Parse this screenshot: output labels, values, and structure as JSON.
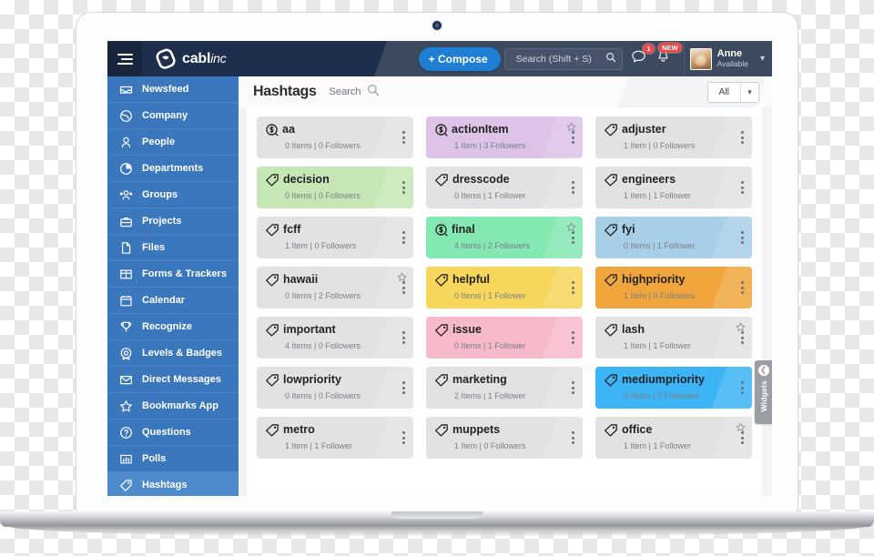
{
  "app": {
    "brand_name": "cabl",
    "brand_name_italic": "inc",
    "hamburger_icon": "hamburger-menu-icon",
    "logo_icon": "cablinc-logo-icon"
  },
  "topbar": {
    "compose_label": "+ Compose",
    "search_placeholder": "Search (Shift + S)",
    "search_value": "",
    "search_icon": "search-icon",
    "messages_icon": "chat-bubble-icon",
    "messages_badge": "1",
    "notifications_icon": "bell-icon",
    "notifications_badge": "NEW",
    "user_name": "Anne",
    "user_status": "Available",
    "user_caret": "chevron-down-icon"
  },
  "sidebar": {
    "items": [
      {
        "label": "Newsfeed",
        "icon": "inbox-icon",
        "active": false
      },
      {
        "label": "Company",
        "icon": "globe-icon",
        "active": false
      },
      {
        "label": "People",
        "icon": "person-icon",
        "active": false
      },
      {
        "label": "Departments",
        "icon": "pie-chart-icon",
        "active": false
      },
      {
        "label": "Groups",
        "icon": "people-group-icon",
        "active": false
      },
      {
        "label": "Projects",
        "icon": "briefcase-icon",
        "active": false
      },
      {
        "label": "Files",
        "icon": "file-icon",
        "active": false
      },
      {
        "label": "Forms & Trackers",
        "icon": "grid-table-icon",
        "active": false
      },
      {
        "label": "Calendar",
        "icon": "calendar-icon",
        "active": false
      },
      {
        "label": "Recognize",
        "icon": "trophy-icon",
        "active": false
      },
      {
        "label": "Levels & Badges",
        "icon": "badge-icon",
        "active": false
      },
      {
        "label": "Direct Messages",
        "icon": "envelope-icon",
        "active": false
      },
      {
        "label": "Bookmarks App",
        "icon": "star-icon",
        "active": false
      },
      {
        "label": "Questions",
        "icon": "question-mark-icon",
        "active": false
      },
      {
        "label": "Polls",
        "icon": "bar-chart-icon",
        "active": false
      },
      {
        "label": "Hashtags",
        "icon": "tag-icon",
        "active": true
      }
    ]
  },
  "page": {
    "title": "Hashtags",
    "search_label": "Search",
    "search_icon": "search-icon",
    "filter_value": "All",
    "filter_caret": "chevron-down-icon"
  },
  "widgets_panel": {
    "label": "Widgets",
    "collapse_icon": "chevron-left-icon"
  },
  "colors": {
    "topbar": "#1e2f4d",
    "topbar_right": "#3c4a60",
    "sidebar": "#3b77bd",
    "sidebar_active": "#4d8bcd",
    "accent_blue": "#1e7fd4",
    "badge_red": "#e94b4b",
    "card_default": "#e2e2e2",
    "card_purple": "#ddc3e8",
    "card_green_light": "#c6e7b5",
    "card_green_mint": "#84e8b2",
    "card_blue_light": "#a8cfe8",
    "card_yellow": "#f7d65c",
    "card_orange": "#f0a63c",
    "card_pink": "#f7bacb",
    "card_blue_bright": "#3cb4f5"
  },
  "cards": [
    {
      "name": "aa",
      "meta": "0 Items | 0 Followers",
      "bg": "#e2e2e2",
      "icon": "tag-dollar-icon",
      "starred": false
    },
    {
      "name": "actionItem",
      "meta": "1 Item | 3 Followers",
      "bg": "#ddc3e8",
      "icon": "tag-dollar-icon",
      "starred": true
    },
    {
      "name": "adjuster",
      "meta": "1 Item | 0 Followers",
      "bg": "#e2e2e2",
      "icon": "tag-icon",
      "starred": false
    },
    {
      "name": "decision",
      "meta": "0 Items | 0 Followers",
      "bg": "#c6e7b5",
      "icon": "tag-icon",
      "starred": false
    },
    {
      "name": "dresscode",
      "meta": "0 Items | 1 Follower",
      "bg": "#e2e2e2",
      "icon": "tag-icon",
      "starred": false
    },
    {
      "name": "engineers",
      "meta": "1 Item | 1 Follower",
      "bg": "#e2e2e2",
      "icon": "tag-icon",
      "starred": false
    },
    {
      "name": "fcff",
      "meta": "1 Item | 0 Followers",
      "bg": "#e2e2e2",
      "icon": "tag-icon",
      "starred": false
    },
    {
      "name": "final",
      "meta": "4 Items | 2 Followers",
      "bg": "#84e8b2",
      "icon": "tag-dollar-icon",
      "starred": true
    },
    {
      "name": "fyi",
      "meta": "0 Items | 1 Follower",
      "bg": "#a8cfe8",
      "icon": "tag-icon",
      "starred": false
    },
    {
      "name": "hawaii",
      "meta": "0 Items | 2 Followers",
      "bg": "#e2e2e2",
      "icon": "tag-icon",
      "starred": true
    },
    {
      "name": "helpful",
      "meta": "0 Items | 1 Follower",
      "bg": "#f7d65c",
      "icon": "tag-icon",
      "starred": false
    },
    {
      "name": "highpriority",
      "meta": "1 Item | 0 Followers",
      "bg": "#f0a63c",
      "icon": "tag-icon",
      "starred": false
    },
    {
      "name": "important",
      "meta": "4 Items | 0 Followers",
      "bg": "#e2e2e2",
      "icon": "tag-icon",
      "starred": false
    },
    {
      "name": "issue",
      "meta": "0 Items | 1 Follower",
      "bg": "#f7bacb",
      "icon": "tag-icon",
      "starred": false
    },
    {
      "name": "lash",
      "meta": "1 Item | 1 Follower",
      "bg": "#e2e2e2",
      "icon": "tag-icon",
      "starred": true
    },
    {
      "name": "lowpriority",
      "meta": "0 Items | 0 Followers",
      "bg": "#e2e2e2",
      "icon": "tag-icon",
      "starred": false
    },
    {
      "name": "marketing",
      "meta": "2 Items | 1 Follower",
      "bg": "#e2e2e2",
      "icon": "tag-icon",
      "starred": false
    },
    {
      "name": "mediumpriority",
      "meta": "0 Items | 0 Followers",
      "bg": "#3cb4f5",
      "icon": "tag-icon",
      "starred": false
    },
    {
      "name": "metro",
      "meta": "1 Item | 1 Follower",
      "bg": "#e2e2e2",
      "icon": "tag-icon",
      "starred": false
    },
    {
      "name": "muppets",
      "meta": "1 Item | 0 Followers",
      "bg": "#e2e2e2",
      "icon": "tag-icon",
      "starred": false
    },
    {
      "name": "office",
      "meta": "1 Item | 1 Follower",
      "bg": "#e2e2e2",
      "icon": "tag-icon",
      "starred": true
    }
  ]
}
